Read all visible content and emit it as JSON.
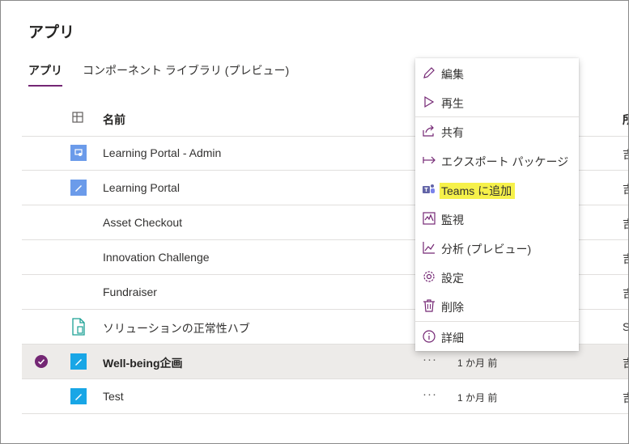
{
  "page": {
    "title": "アプリ"
  },
  "tabs": [
    {
      "label": "アプリ",
      "active": true
    },
    {
      "label": "コンポーネント ライブラリ (プレビュー)",
      "active": false
    }
  ],
  "table": {
    "headers": {
      "name": "名前",
      "owner": "所"
    },
    "rows": [
      {
        "name": "Learning Portal - Admin",
        "owner": "吉",
        "icon": "canvas-app-icon"
      },
      {
        "name": "Learning Portal",
        "owner": "吉",
        "icon": "pencil-app-icon"
      },
      {
        "name": "Asset Checkout",
        "owner": "吉",
        "icon": ""
      },
      {
        "name": "Innovation Challenge",
        "owner": "吉",
        "icon": ""
      },
      {
        "name": "Fundraiser",
        "owner": "吉",
        "icon": ""
      },
      {
        "name": "ソリューションの正常性ハブ",
        "owner": "S",
        "icon": "document-app-icon"
      },
      {
        "name": "Well-being企画",
        "owner": "吉",
        "selected": true,
        "more": "···",
        "modified": "1 か月 前",
        "icon": "pencil-app-icon"
      },
      {
        "name": "Test",
        "owner": "吉",
        "more": "···",
        "modified": "1 か月 前",
        "icon": "pencil-app-icon"
      }
    ]
  },
  "context_menu": {
    "items": [
      {
        "label": "編集",
        "icon": "pencil-icon"
      },
      {
        "label": "再生",
        "icon": "play-icon"
      },
      {
        "label": "共有",
        "icon": "share-icon"
      },
      {
        "label": "エクスポート パッケージ",
        "icon": "export-arrow-icon"
      },
      {
        "label": "Teams に追加",
        "icon": "teams-icon",
        "highlighted": true
      },
      {
        "label": "監視",
        "icon": "monitor-icon"
      },
      {
        "label": "分析 (プレビュー)",
        "icon": "analytics-icon"
      },
      {
        "label": "設定",
        "icon": "gear-icon"
      },
      {
        "label": "削除",
        "icon": "trash-icon"
      },
      {
        "label": "詳細",
        "icon": "info-icon"
      }
    ]
  },
  "colors": {
    "accent": "#742774",
    "highlight": "#f6f14a",
    "app_icon_blue": "#4c8fdd",
    "app_icon_cyan": "#18a6e6"
  }
}
